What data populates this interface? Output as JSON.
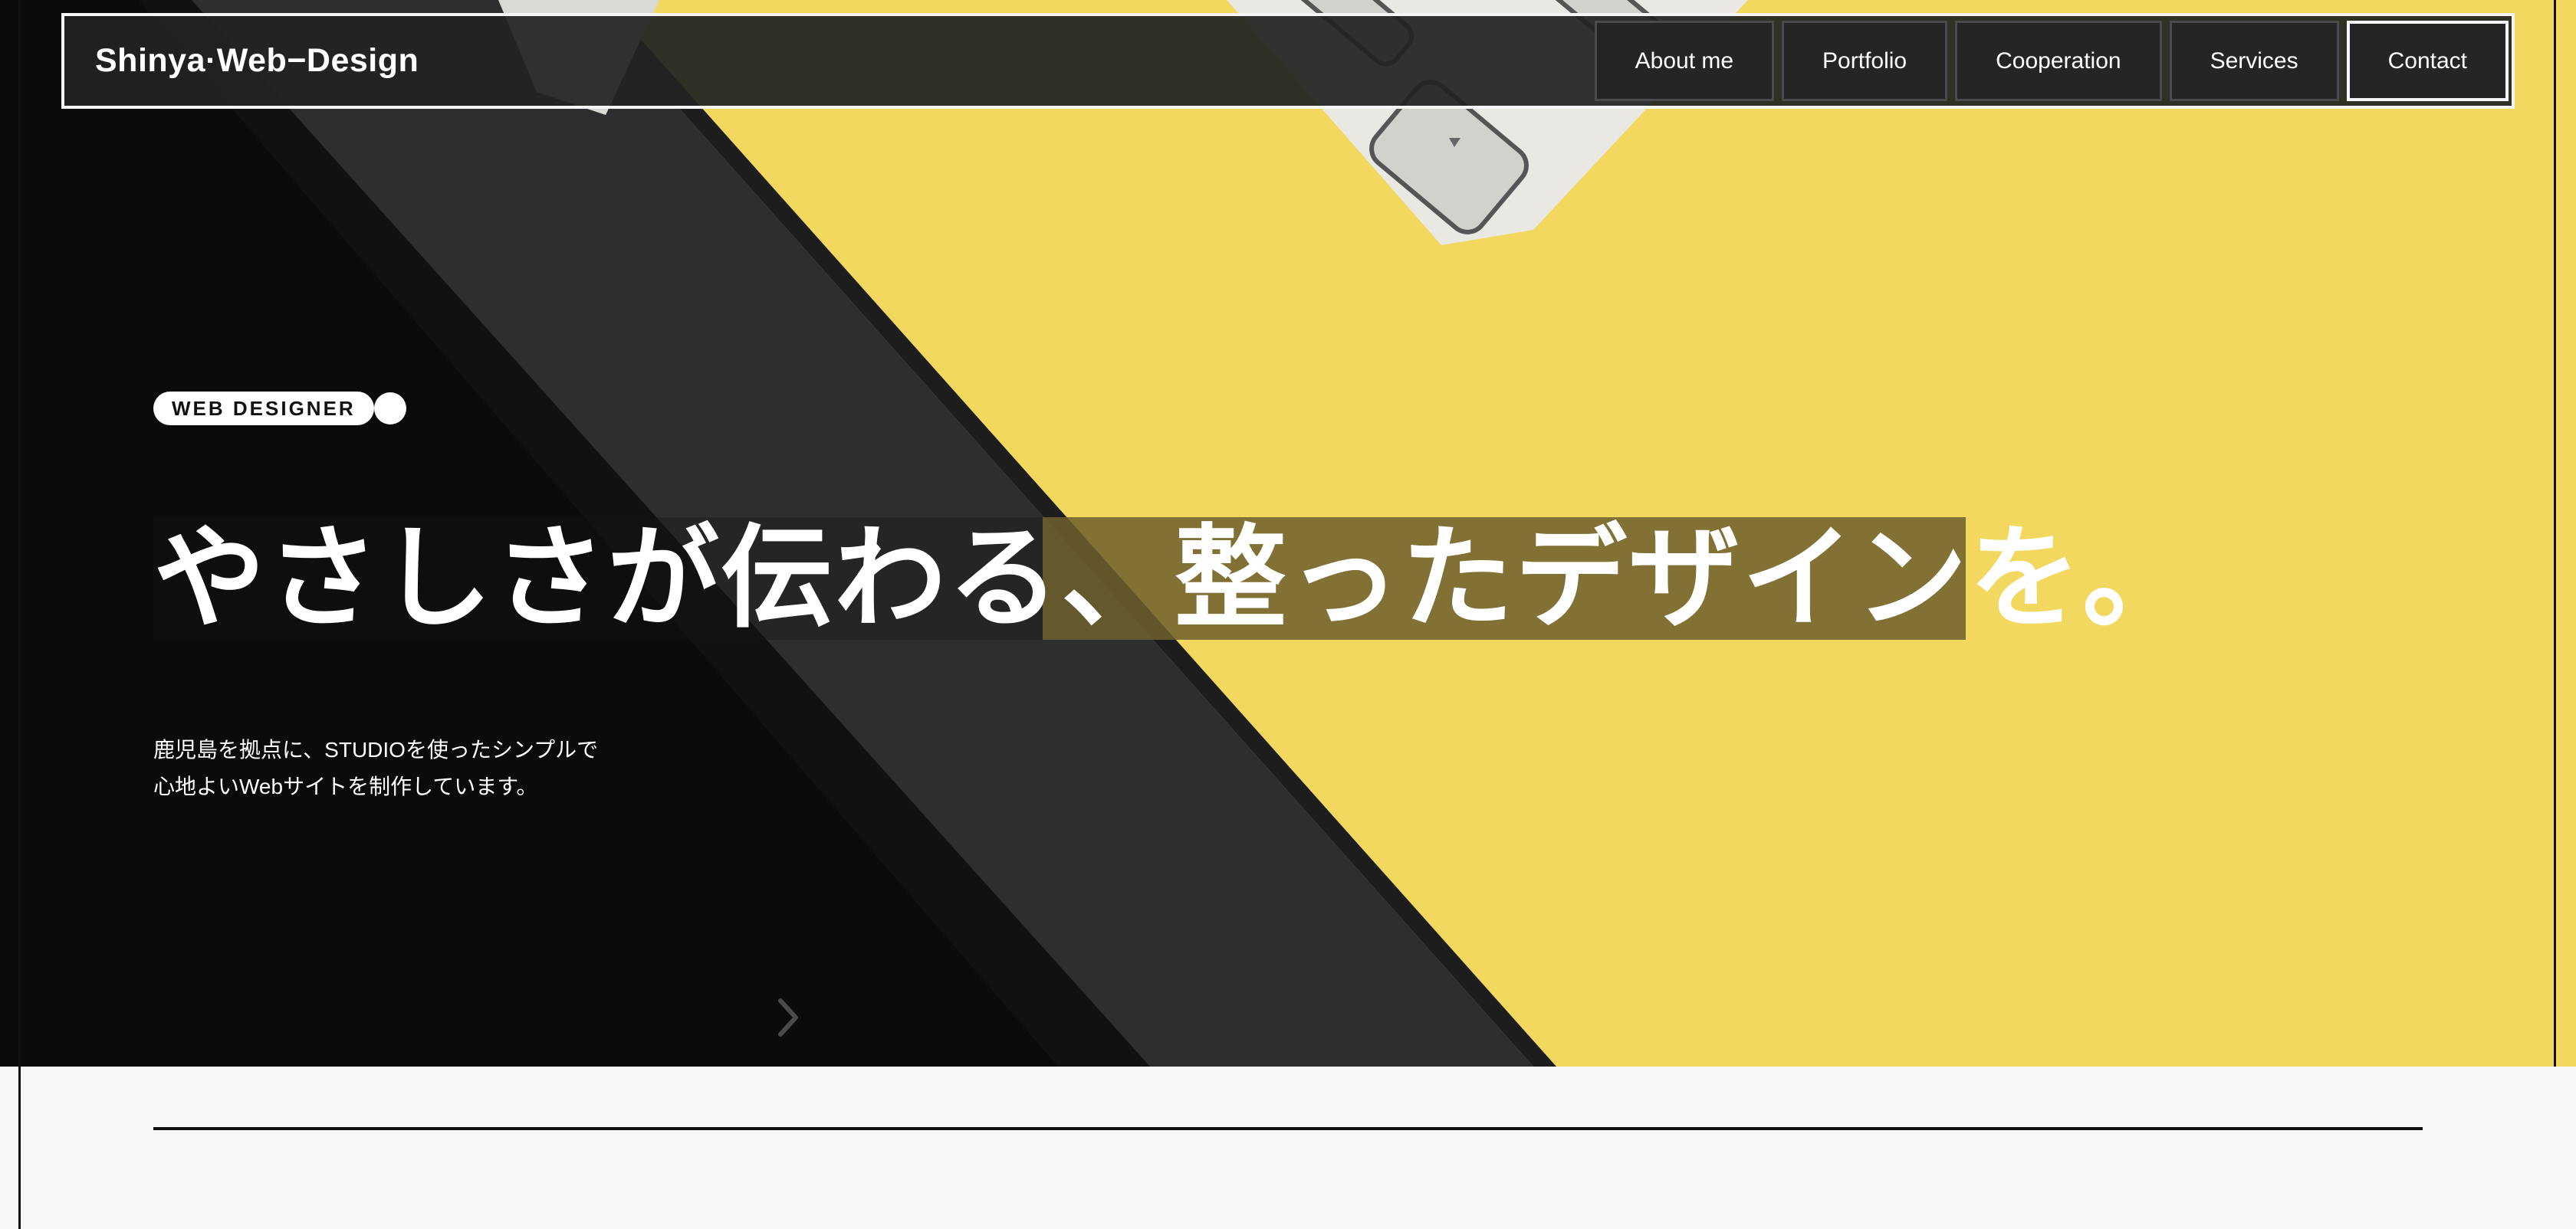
{
  "header": {
    "logo": "Shinya·Web−Design",
    "nav": [
      {
        "label": "About me"
      },
      {
        "label": "Portfolio"
      },
      {
        "label": "Cooperation"
      },
      {
        "label": "Services"
      },
      {
        "label": "Contact"
      }
    ]
  },
  "hero": {
    "badge": "WEB DESIGNER",
    "headline": "やさしさが伝わる、整ったデザインを。",
    "lead_line1": "鹿児島を拠点に、STUDIOを使ったシンプルで",
    "lead_line2": "心地よいWebサイトを制作しています。",
    "next_icon": "chevron-right-icon"
  },
  "colors": {
    "accent_yellow": "#f2d75c",
    "header_bg": "#222222",
    "text_light": "#ffffff",
    "page_bg": "#f7f7f7"
  }
}
